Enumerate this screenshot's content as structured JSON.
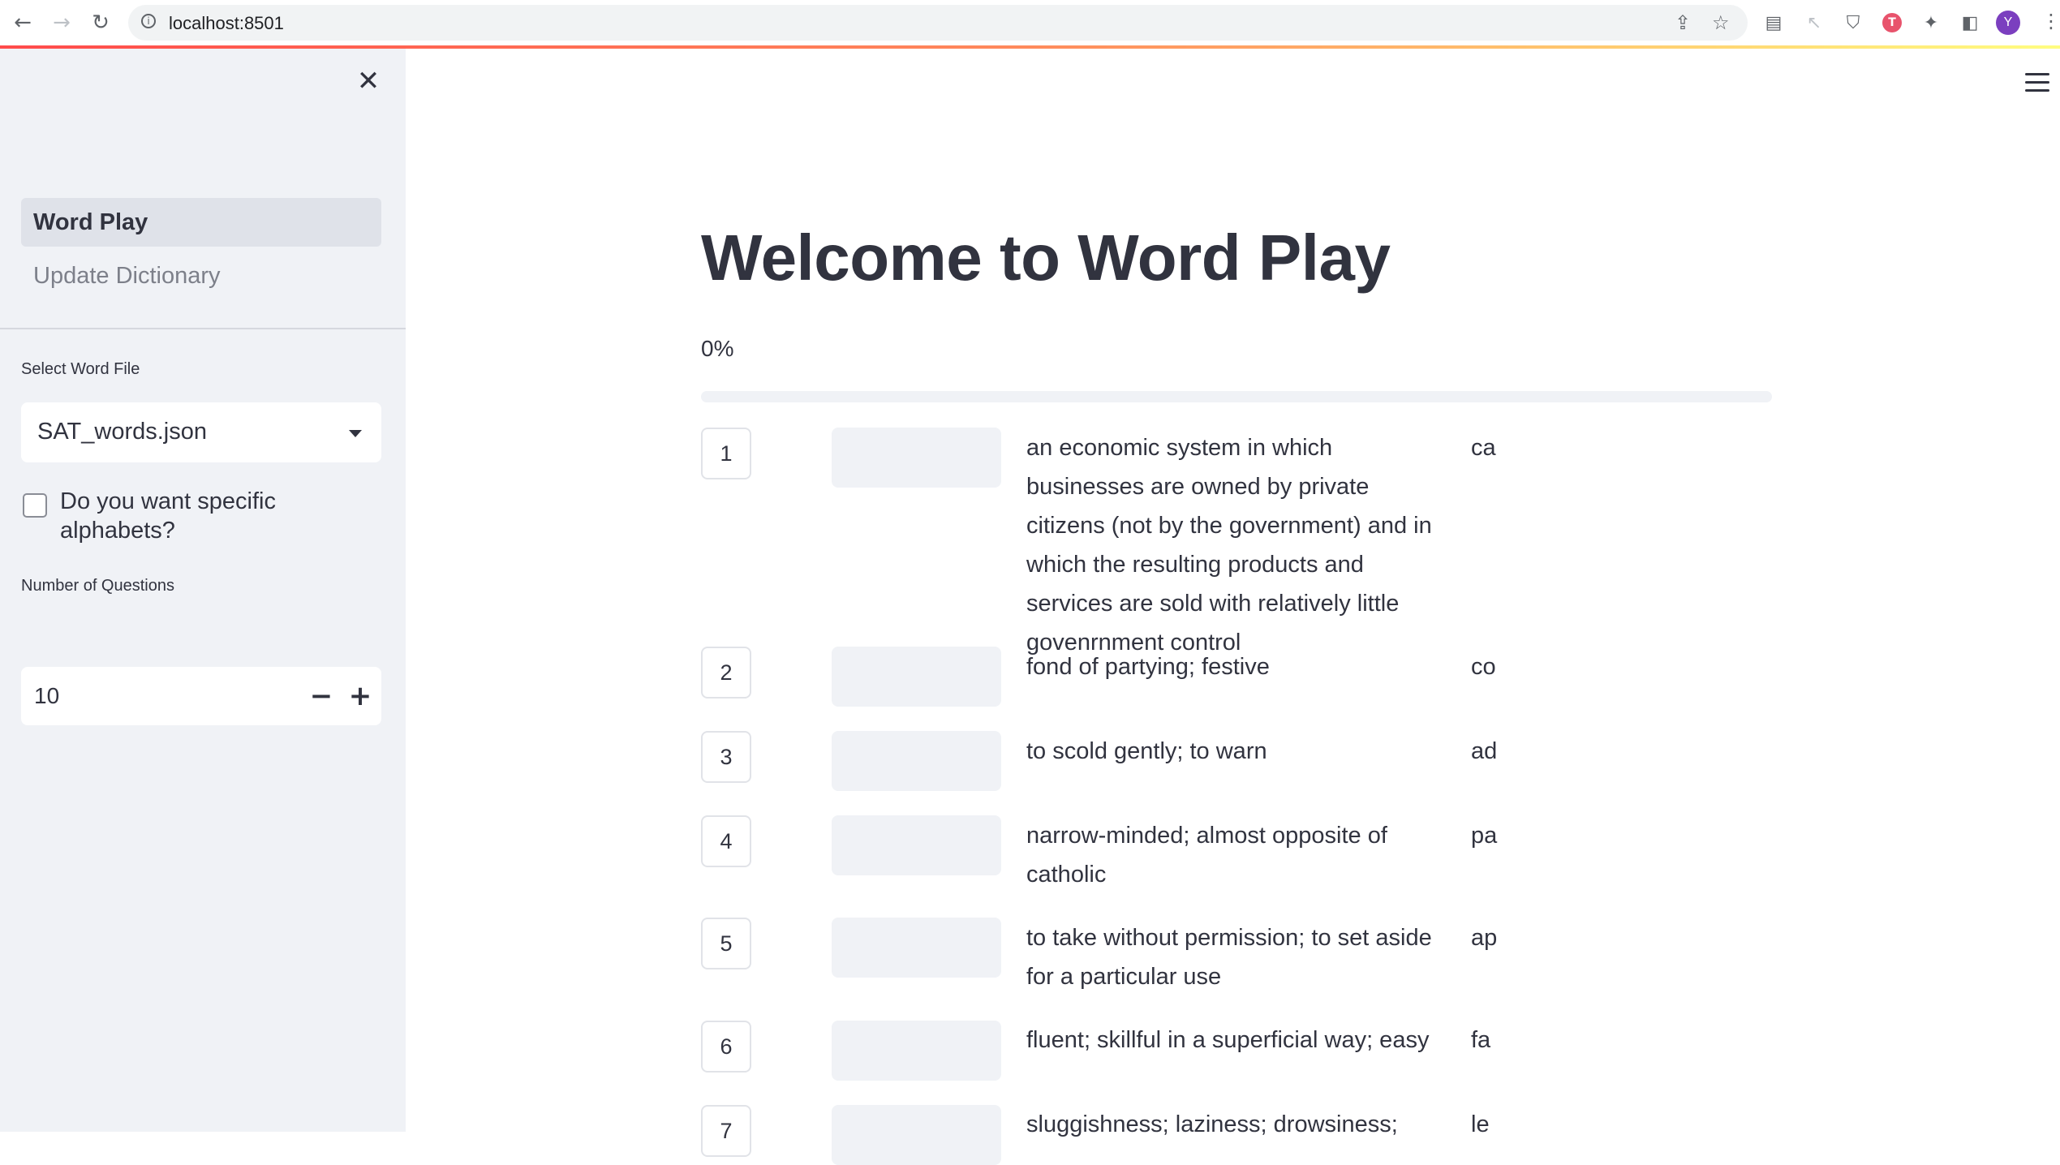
{
  "browser": {
    "url": "localhost:8501",
    "profile_initial": "Y",
    "extension_badge": "T"
  },
  "sidebar": {
    "nav": [
      {
        "label": "Word Play",
        "active": true
      },
      {
        "label": "Update Dictionary",
        "active": false
      }
    ],
    "word_file": {
      "label": "Select Word File",
      "value": "SAT_words.json"
    },
    "specific_alphabets": {
      "label": "Do you want specific alphabets?",
      "checked": false
    },
    "num_questions": {
      "label": "Number of Questions",
      "value": "10",
      "minus": "−",
      "plus": "+"
    }
  },
  "main": {
    "title": "Welcome to Word Play",
    "progress": {
      "text": "0%",
      "value": 0
    },
    "questions": [
      {
        "num": "1",
        "definition": "an economic system in which businesses are owned by private citizens (not by the government) and in which the resulting products and services are sold with relatively little govenrnment control",
        "hint": "ca"
      },
      {
        "num": "2",
        "definition": "fond of partying; festive",
        "hint": "co"
      },
      {
        "num": "3",
        "definition": "to scold gently; to warn",
        "hint": "ad"
      },
      {
        "num": "4",
        "definition": "narrow-minded; almost opposite of catholic",
        "hint": "pa"
      },
      {
        "num": "5",
        "definition": "to take without permission; to set aside for a particular use",
        "hint": "ap"
      },
      {
        "num": "6",
        "definition": "fluent; skillful in a superficial way; easy",
        "hint": "fa"
      },
      {
        "num": "7",
        "definition": "sluggishness; laziness; drowsiness;",
        "hint": "le"
      }
    ]
  },
  "colors": {
    "sidebar_bg": "#f0f2f6",
    "text": "#31333f",
    "accent": "#ff4b4b"
  },
  "icons": {
    "back": "back-arrow-icon",
    "forward": "forward-arrow-icon",
    "reload": "reload-icon",
    "close": "close-icon",
    "menu": "hamburger-menu-icon",
    "dropdown": "caret-down-icon"
  }
}
